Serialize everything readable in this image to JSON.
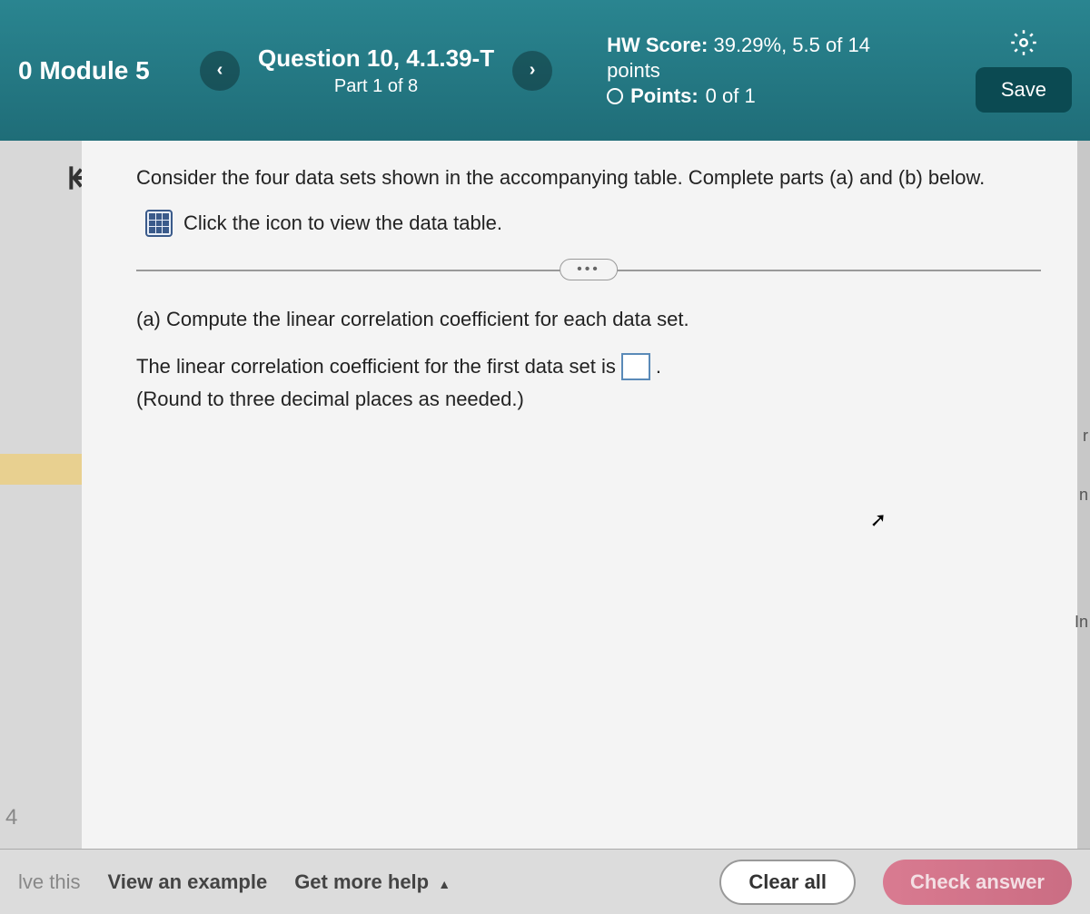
{
  "header": {
    "module": "0 Module 5",
    "question_title": "Question 10, 4.1.39-T",
    "question_part": "Part 1 of 8",
    "hw_score_label": "HW Score:",
    "hw_score_value": "39.29%, 5.5 of 14",
    "points_word": "points",
    "points_label": "Points:",
    "points_value": "0 of 1",
    "save": "Save"
  },
  "content": {
    "instruction": "Consider the four data sets shown in the accompanying table. Complete parts (a) and (b) below.",
    "data_link": "Click the icon to view the data table.",
    "part_a": "(a) Compute the linear correlation coefficient for each data set.",
    "answer_pre": "The linear correlation coefficient for the first data set is",
    "answer_post": ".",
    "hint": "(Round to three decimal places as needed.)"
  },
  "left": {
    "num": "4"
  },
  "right_rail": {
    "m1": "r",
    "m2": "n",
    "m3": "In"
  },
  "footer": {
    "solve": "lve this",
    "view_example": "View an example",
    "get_help": "Get more help",
    "clear": "Clear all",
    "check": "Check answer"
  }
}
